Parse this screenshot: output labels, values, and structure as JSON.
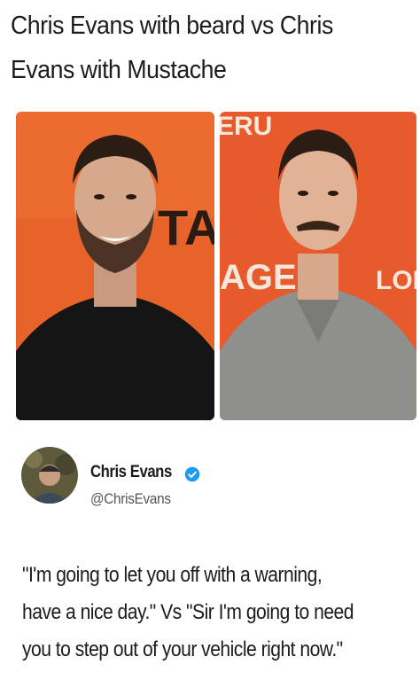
{
  "caption": {
    "line1": "Chris Evans with beard vs Chris",
    "line2": "Evans with Mustache"
  },
  "photos": {
    "left": {
      "backdrop_text": "TAG"
    },
    "right": {
      "backdrop_text_top": "ERU",
      "backdrop_text_mid": "AGE",
      "backdrop_text_right": "LOBE"
    }
  },
  "tweet": {
    "author_name": "Chris Evans",
    "handle": "@ChrisEvans",
    "verified_icon": "verified-badge-icon",
    "lines": [
      "\"I'm going to let you off with a warning,",
      "have a nice day.\" Vs \"Sir I'm going to need",
      "you to step out of your vehicle right now.\""
    ]
  },
  "colors": {
    "backdrop_orange": "#e8632a",
    "verified_blue": "#1d9bf0"
  }
}
